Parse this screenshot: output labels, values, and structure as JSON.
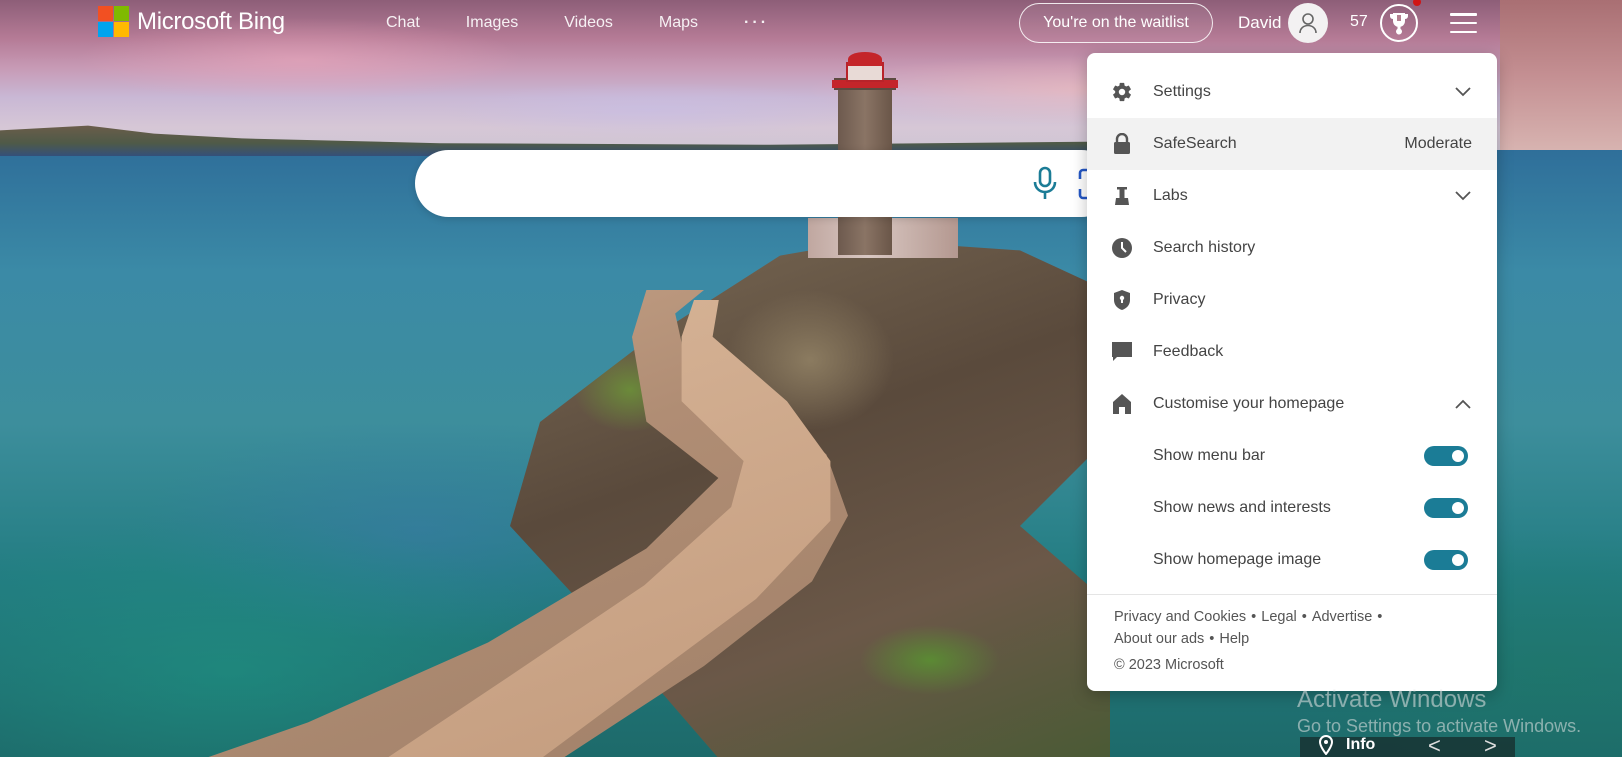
{
  "header": {
    "logo_text": "Microsoft Bing",
    "logo_colors": [
      "#f25022",
      "#7fba00",
      "#00a4ef",
      "#ffb900"
    ],
    "nav": [
      {
        "label": "Chat"
      },
      {
        "label": "Images"
      },
      {
        "label": "Videos"
      },
      {
        "label": "Maps"
      },
      {
        "label": "···"
      }
    ],
    "waitlist_label": "You're on the waitlist",
    "user_name": "David",
    "rewards_points": "57",
    "notification_dot_color": "#d01414"
  },
  "search": {
    "value": "",
    "placeholder": "",
    "accent_color": "#1b7c96"
  },
  "settings_panel": {
    "items": [
      {
        "label": "Settings",
        "icon": "gear-icon",
        "chevron": "down"
      },
      {
        "label": "SafeSearch",
        "icon": "lock-icon",
        "value": "Moderate"
      },
      {
        "label": "Labs",
        "icon": "flask-icon",
        "chevron": "down"
      },
      {
        "label": "Search history",
        "icon": "clock-icon"
      },
      {
        "label": "Privacy",
        "icon": "shield-icon"
      },
      {
        "label": "Feedback",
        "icon": "feedback-icon"
      },
      {
        "label": "Customise your homepage",
        "icon": "home-icon",
        "chevron": "up"
      }
    ],
    "homepage_options": [
      {
        "label": "Show menu bar",
        "enabled": true
      },
      {
        "label": "Show news and interests",
        "enabled": true
      },
      {
        "label": "Show homepage image",
        "enabled": true
      }
    ],
    "toggle_color": "#1b7c96",
    "footer_links": [
      "Privacy and Cookies",
      "Legal",
      "Advertise",
      "About our ads",
      "Help"
    ],
    "copyright": "© 2023 Microsoft"
  },
  "watermark": {
    "title": "Activate Windows",
    "subtitle": "Go to Settings to activate Windows."
  },
  "image_info": {
    "info_label": "Info",
    "prev_label": "<",
    "next_label": ">"
  }
}
